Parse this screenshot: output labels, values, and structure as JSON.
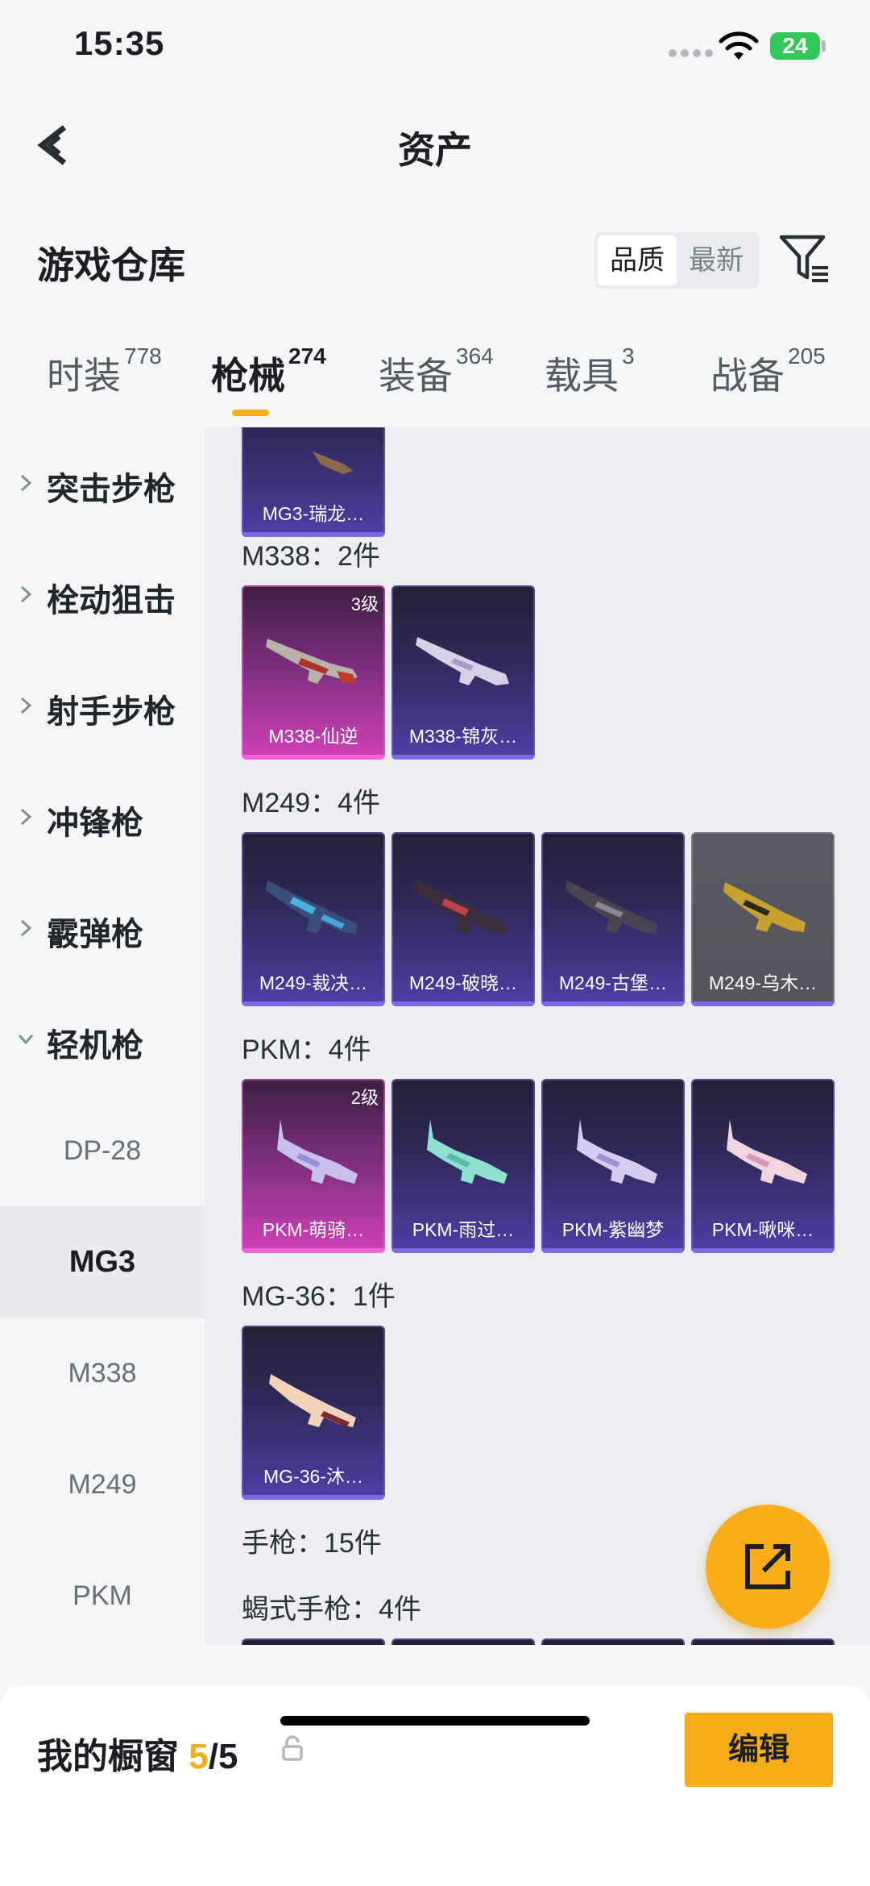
{
  "status": {
    "time": "15:35",
    "battery": "24"
  },
  "header": {
    "title": "资产"
  },
  "section": {
    "title": "游戏仓库",
    "sort_quality": "品质",
    "sort_latest": "最新"
  },
  "tabs": [
    {
      "label": "时装",
      "count": "778"
    },
    {
      "label": "枪械",
      "count": "274"
    },
    {
      "label": "装备",
      "count": "364"
    },
    {
      "label": "载具",
      "count": "3"
    },
    {
      "label": "战备",
      "count": "205"
    }
  ],
  "sidebar": {
    "categories": [
      "突击步枪",
      "栓动狙击",
      "射手步枪",
      "冲锋枪",
      "霰弹枪",
      "轻机枪"
    ],
    "sub": [
      "DP-28",
      "MG3",
      "M338",
      "M249",
      "PKM"
    ]
  },
  "content": {
    "top_card": "MG3-瑞龙…",
    "groups": [
      {
        "label": "M338：2件",
        "items": [
          {
            "name": "M338-仙逆",
            "level": "3级"
          },
          {
            "name": "M338-锦灰…"
          }
        ]
      },
      {
        "label": "M249：4件",
        "items": [
          {
            "name": "M249-裁决…"
          },
          {
            "name": "M249-破晓…"
          },
          {
            "name": "M249-古堡…"
          },
          {
            "name": "M249-乌木…"
          }
        ]
      },
      {
        "label": "PKM：4件",
        "items": [
          {
            "name": "PKM-萌骑…",
            "level": "2级"
          },
          {
            "name": "PKM-雨过…"
          },
          {
            "name": "PKM-紫幽梦"
          },
          {
            "name": "PKM-啾咪…"
          }
        ]
      },
      {
        "label": "MG-36：1件",
        "items": [
          {
            "name": "MG-36-沐…"
          }
        ]
      }
    ],
    "pistol_label": "手枪：15件",
    "scorpion_label": "蝎式手枪：4件"
  },
  "bottom": {
    "showcase_label": "我的橱窗 ",
    "count_current": "5",
    "count_total": "/5",
    "edit": "编辑"
  },
  "colors": {
    "accent": "#f6ac17",
    "purple_card": "#4e3ea6",
    "pink_card": "#d040b8"
  },
  "icons": [
    "back-arrow-icon",
    "filter-icon",
    "share-icon",
    "lock-icon",
    "chevron-right-icon",
    "chevron-down-icon"
  ]
}
